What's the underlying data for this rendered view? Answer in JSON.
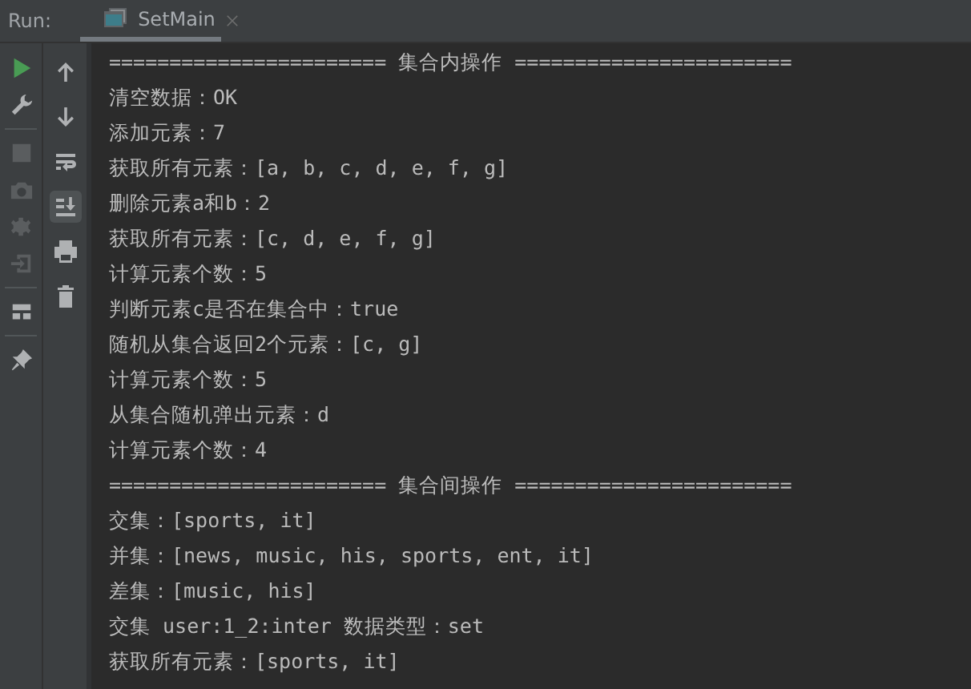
{
  "run_panel": {
    "label": "Run:",
    "tabs": [
      {
        "title": "SetMain",
        "selected": true,
        "closable": true
      }
    ]
  },
  "left_toolbar": [
    {
      "kind": "run",
      "disabled": false
    },
    {
      "kind": "wrench",
      "disabled": false
    },
    {
      "kind": "separator"
    },
    {
      "kind": "stop",
      "disabled": true
    },
    {
      "kind": "camera",
      "disabled": true
    },
    {
      "kind": "bug",
      "disabled": true
    },
    {
      "kind": "login",
      "disabled": true
    },
    {
      "kind": "separator"
    },
    {
      "kind": "layout",
      "disabled": false
    },
    {
      "kind": "separator"
    },
    {
      "kind": "pin",
      "disabled": false
    }
  ],
  "right_toolbar": [
    {
      "kind": "up",
      "selected": false
    },
    {
      "kind": "down",
      "selected": false
    },
    {
      "kind": "wrap",
      "selected": false
    },
    {
      "kind": "scroll",
      "selected": true
    },
    {
      "kind": "print",
      "selected": false
    },
    {
      "kind": "trash",
      "selected": false
    }
  ],
  "console": {
    "lines": [
      "======================= 集合内操作 =======================",
      "清空数据：OK",
      "添加元素：7",
      "获取所有元素：[a, b, c, d, e, f, g]",
      "删除元素a和b：2",
      "获取所有元素：[c, d, e, f, g]",
      "计算元素个数：5",
      "判断元素c是否在集合中：true",
      "随机从集合返回2个元素：[c, g]",
      "计算元素个数：5",
      "从集合随机弹出元素：d",
      "计算元素个数：4",
      "======================= 集合间操作 =======================",
      "交集：[sports, it]",
      "并集：[news, music, his, sports, ent, it]",
      "差集：[music, his]",
      "交集 user:1_2:inter 数据类型：set",
      "获取所有元素：[sports, it]"
    ]
  }
}
